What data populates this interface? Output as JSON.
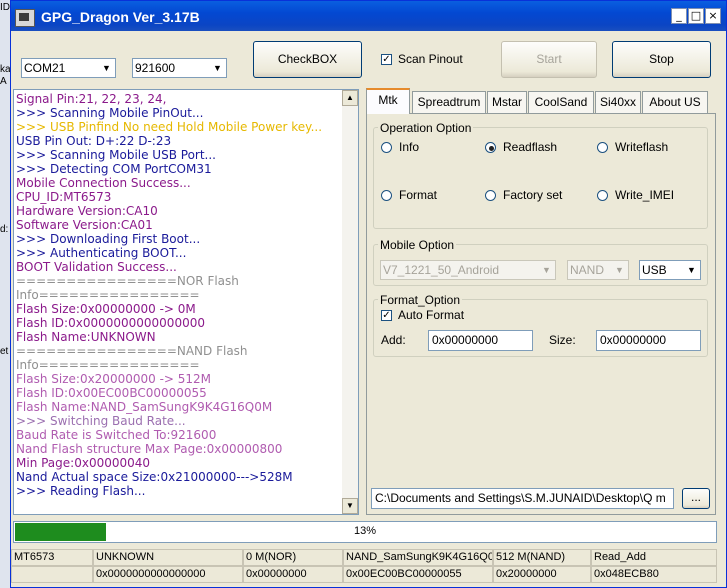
{
  "window": {
    "title": "GPG_Dragon  Ver_3.17B"
  },
  "toolbar": {
    "port": "COM21",
    "baud": "921600",
    "checkbox_button": "CheckBOX",
    "scan_pinout_label": "Scan Pinout",
    "start_button": "Start",
    "stop_button": "Stop"
  },
  "log": [
    {
      "text": "   Signal Pin:21, 22, 23, 24,",
      "color": "#8b1a8b"
    },
    {
      "text": ">>> Scanning Mobile PinOut...",
      "color": "#1a1a9a"
    },
    {
      "text": ">>> USB Pinfind No need Hold Mobile Power key...",
      "color": "#e6b800"
    },
    {
      "text": "   USB Pin Out: D+:22  D-:23",
      "color": "#1a1a9a"
    },
    {
      "text": ">>> Scanning Mobile USB Port...",
      "color": "#1a1a9a"
    },
    {
      "text": ">>> Detecting COM PortCOM31",
      "color": "#1a1a9a"
    },
    {
      "text": "   Mobile Connection Success...",
      "color": "#8b1a8b"
    },
    {
      "text": "   CPU_ID:MT6573",
      "color": "#8b1a8b"
    },
    {
      "text": "   Hardware Version:CA10",
      "color": "#8b1a8b"
    },
    {
      "text": "   Software Version:CA01",
      "color": "#8b1a8b"
    },
    {
      "text": ">>> Downloading First Boot...",
      "color": "#1a1a9a"
    },
    {
      "text": ">>> Authenticating BOOT...",
      "color": "#1a1a9a"
    },
    {
      "text": "   BOOT Validation Success...",
      "color": "#8b1a8b"
    },
    {
      "text": "   ================NOR Flash",
      "color": "#909090"
    },
    {
      "text": "Info================",
      "color": "#909090"
    },
    {
      "text": "   Flash Size:0x00000000 -> 0M",
      "color": "#8b1a8b"
    },
    {
      "text": "   Flash ID:0x0000000000000000",
      "color": "#8b1a8b"
    },
    {
      "text": "   Flash Name:UNKNOWN",
      "color": "#8b1a8b"
    },
    {
      "text": "   ================NAND Flash",
      "color": "#909090"
    },
    {
      "text": "Info================",
      "color": "#909090"
    },
    {
      "text": "   Flash Size:0x20000000 -> 512M",
      "color": "#b05cb0"
    },
    {
      "text": "   Flash ID:0x00EC00BC00000055",
      "color": "#b05cb0"
    },
    {
      "text": "   Flash Name:NAND_SamSungK9K4G16Q0M",
      "color": "#b05cb0"
    },
    {
      "text": ">>> Switching Baud Rate...",
      "color": "#9b6fb0"
    },
    {
      "text": "    Baud Rate is Switched To:921600",
      "color": "#b05cb0"
    },
    {
      "text": "   Nand Flash  structure  Max Page:0x00000800",
      "color": "#b05cb0"
    },
    {
      "text": "Min Page:0x00000040",
      "color": "#8b1a8b"
    },
    {
      "text": "   Nand Actual space  Size:0x21000000--->528M",
      "color": "#1a1a9a"
    },
    {
      "text": ">>> Reading Flash...",
      "color": "#1a1a9a"
    }
  ],
  "tabs": [
    "Mtk",
    "Spreadtrum",
    "Mstar",
    "CoolSand",
    "Si40xx",
    "About US"
  ],
  "operation": {
    "title": "Operation Option",
    "info": "Info",
    "readflash": "Readflash",
    "writeflash": "Writeflash",
    "format": "Format",
    "factory": "Factory set",
    "write_imei": "Write_IMEI"
  },
  "mobile": {
    "title": "Mobile Option",
    "model": "V7_1221_50_Android",
    "flash": "NAND",
    "conn": "USB"
  },
  "format_option": {
    "title": "Format_Option",
    "auto_format": "Auto Format",
    "add_label": "Add:",
    "add_value": "0x00000000",
    "size_label": "Size:",
    "size_value": "0x00000000"
  },
  "path": {
    "value": "C:\\Documents and Settings\\S.M.JUNAID\\Desktop\\Q m",
    "browse": "..."
  },
  "progress": {
    "percent": 13,
    "label": "13%"
  },
  "statusbar": {
    "row1": [
      "MT6573",
      "UNKNOWN",
      "0 M(NOR)",
      "NAND_SamSungK9K4G16Q0M",
      "512 M(NAND)",
      "Read_Add"
    ],
    "row2": [
      "",
      "0x0000000000000000",
      "0x00000000",
      "0x00EC00BC00000055",
      "0x20000000",
      "0x048ECB80"
    ]
  },
  "desktop_strip": [
    "ID",
    "ka",
    "A",
    "d:",
    "et"
  ],
  "colors": {
    "title_blue": "#0348d2",
    "progress_green": "#1e8c1e"
  }
}
